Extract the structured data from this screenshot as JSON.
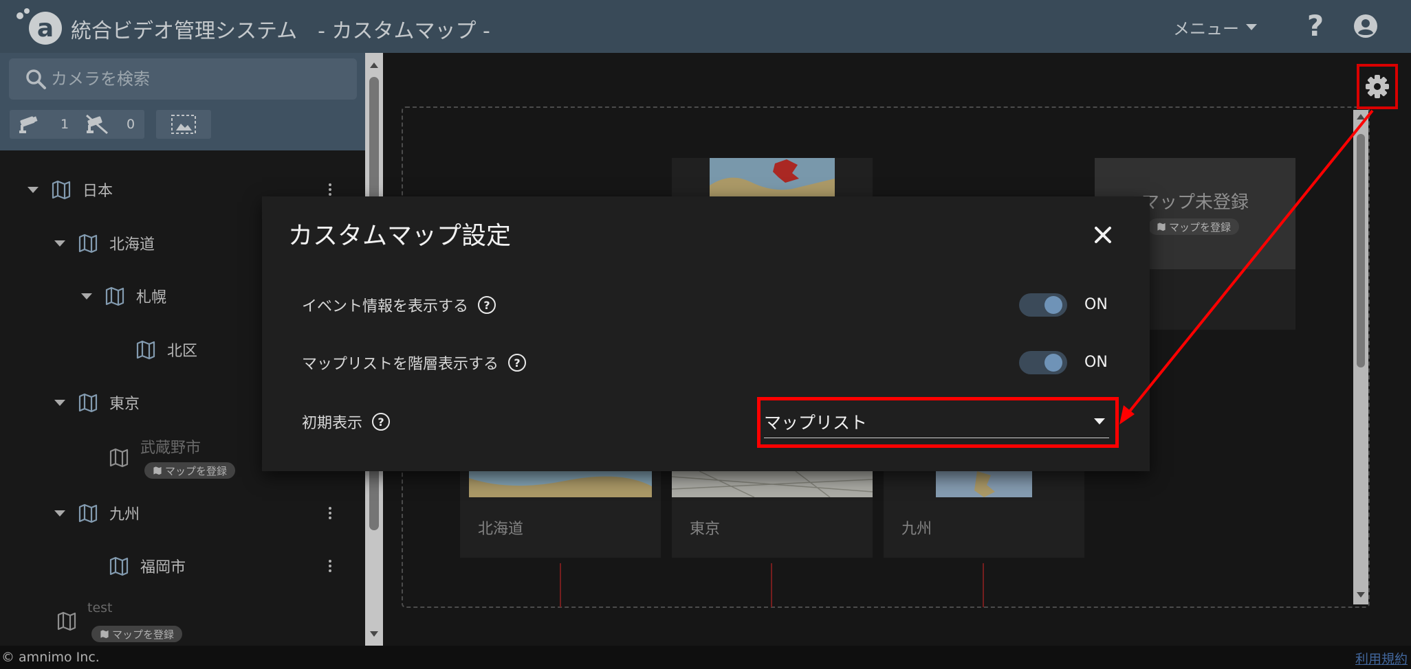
{
  "header": {
    "title": "統合ビデオ管理システム　- カスタムマップ -",
    "menu_label": "メニュー",
    "help_glyph": "?"
  },
  "sidebar": {
    "search_placeholder": "カメラを検索",
    "chips": [
      {
        "icon": "camera-online-icon",
        "count": "1"
      },
      {
        "icon": "camera-offline-icon",
        "count": "0"
      },
      {
        "icon": "image-select-icon"
      }
    ],
    "tree": [
      {
        "label": "日本",
        "level": 0,
        "expanded": true,
        "menu": true
      },
      {
        "label": "北海道",
        "level": 1,
        "expanded": true
      },
      {
        "label": "札幌",
        "level": 2,
        "expanded": true
      },
      {
        "label": "北区",
        "level": 3
      },
      {
        "label": "東京",
        "level": 1,
        "expanded": true
      },
      {
        "label": "武蔵野市",
        "level": 2,
        "unregistered": true
      },
      {
        "label": "九州",
        "level": 1,
        "expanded": true,
        "menu": true
      },
      {
        "label": "福岡市",
        "level": 2,
        "menu": true
      },
      {
        "label": "test",
        "level": 0,
        "unregistered": true
      }
    ],
    "register_badge": "マップを登録"
  },
  "main": {
    "unregistered_card": {
      "title": "マップ未登録",
      "badge": "マップを登録"
    },
    "cards": [
      "北海道",
      "東京",
      "九州"
    ]
  },
  "dialog": {
    "title": "カスタムマップ設定",
    "settings": [
      {
        "label": "イベント情報を表示する",
        "state": "ON"
      },
      {
        "label": "マップリストを階層表示する",
        "state": "ON"
      }
    ],
    "initial_display_label": "初期表示",
    "initial_display_value": "マップリスト"
  },
  "footer": {
    "copyright": "© amnimo Inc.",
    "terms": "利用規約"
  },
  "colors": {
    "header_bg": "#435868",
    "highlight": "#ff0000",
    "toggle_knob": "#6f93b7"
  }
}
